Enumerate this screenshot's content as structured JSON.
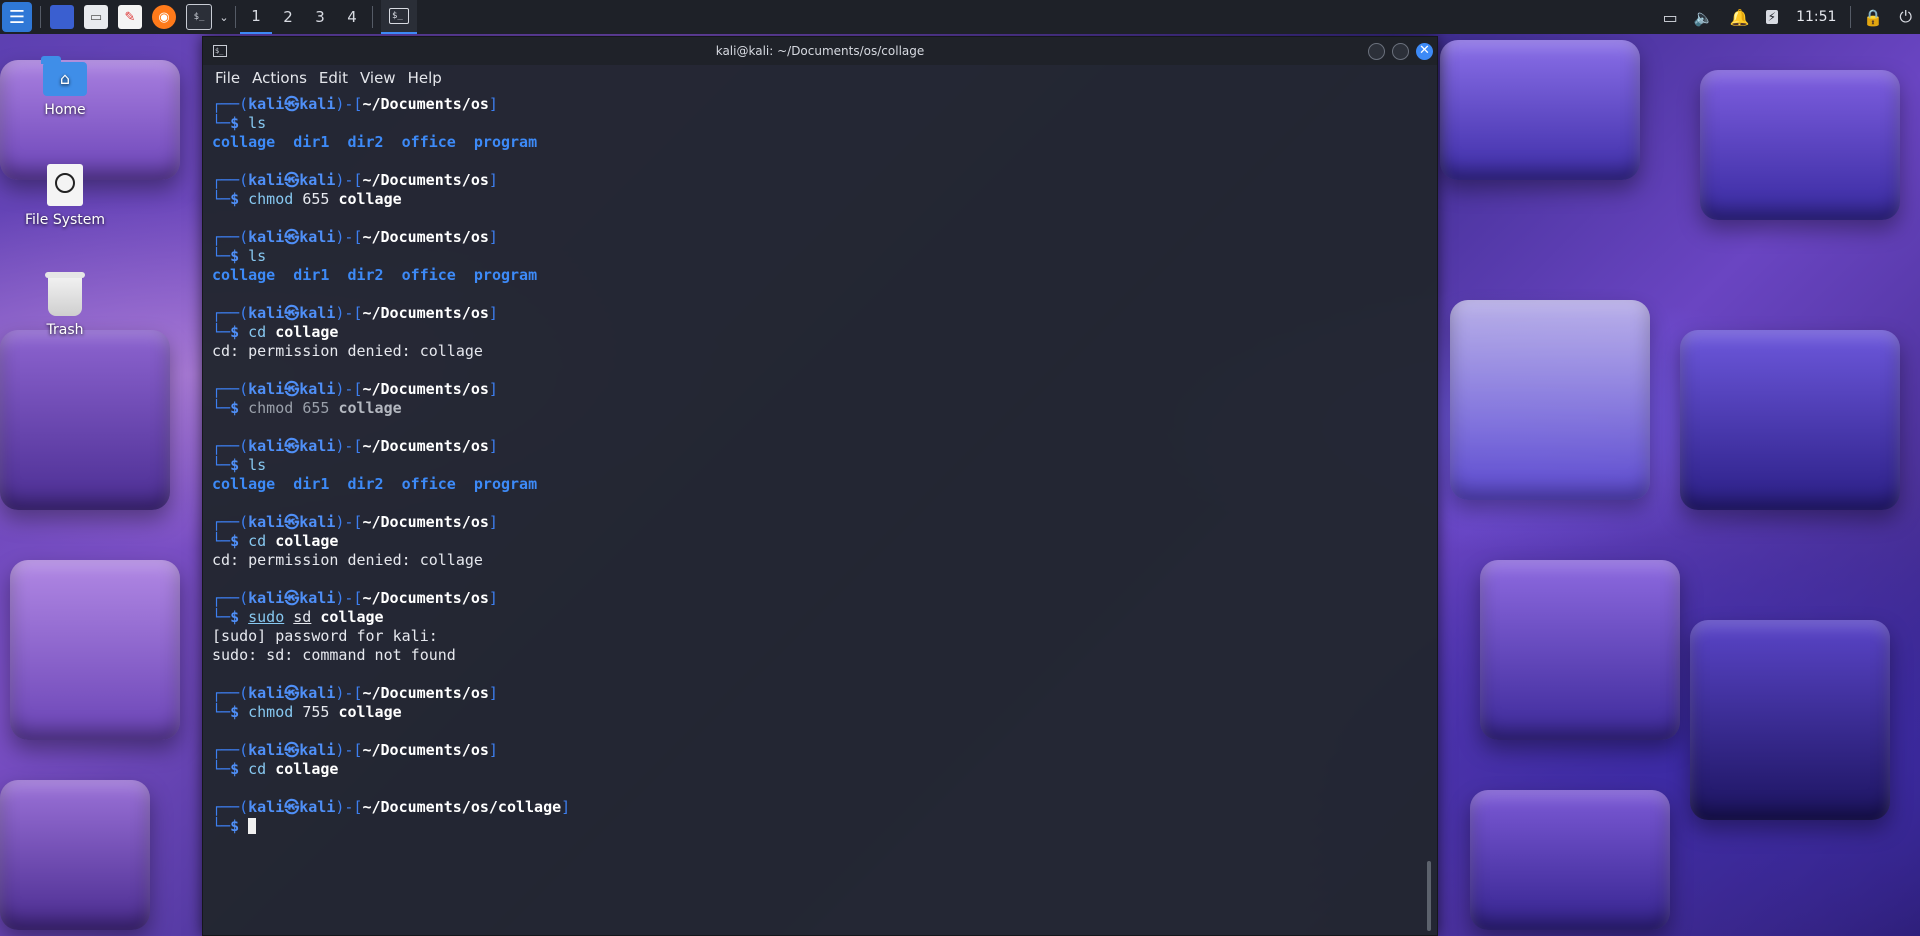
{
  "panel": {
    "workspaces": [
      "1",
      "2",
      "3",
      "4"
    ],
    "clock": "11:51",
    "icons": [
      "kali-menu-icon",
      "show-desktop-icon",
      "file-manager-icon",
      "text-editor-icon",
      "firefox-icon",
      "terminal-icon",
      "chevron-down-icon",
      "display-icon",
      "volume-icon",
      "notification-icon",
      "battery-icon",
      "lock-icon",
      "power-icon"
    ]
  },
  "desktop": {
    "icons": [
      {
        "label": "Home",
        "icon": "home-folder-icon"
      },
      {
        "label": "File System",
        "icon": "drive-icon"
      },
      {
        "label": "Trash",
        "icon": "trash-icon"
      }
    ]
  },
  "window": {
    "title": "kali@kali: ~/Documents/os/collage",
    "menu": [
      "File",
      "Actions",
      "Edit",
      "View",
      "Help"
    ]
  },
  "terminal": {
    "prompt_top": "┌──(",
    "prompt_bottom": "└─",
    "user": "kali㉿kali",
    "mid": ")-[",
    "close_bracket": "]",
    "dollar": "$",
    "path_os": "~/Documents/os",
    "path_collage": "~/Documents/os/collage",
    "ls_entries": [
      "collage",
      "dir1",
      "dir2",
      "office",
      "program"
    ],
    "commands": [
      {
        "cmd": "ls",
        "args": ""
      },
      {
        "cmd": "chmod",
        "num": "655",
        "args": "collage"
      },
      {
        "cmd": "ls",
        "args": ""
      },
      {
        "cmd": "cd",
        "args": "collage"
      },
      {
        "cmd": "chmod",
        "num": "655",
        "args": "collage"
      },
      {
        "cmd": "ls",
        "args": ""
      },
      {
        "cmd": "cd",
        "args": "collage"
      },
      {
        "cmd": "sudo",
        "sub": "sd",
        "args": "collage"
      },
      {
        "cmd": "chmod",
        "num": "755",
        "args": "collage"
      },
      {
        "cmd": "cd",
        "args": "collage"
      }
    ],
    "outputs": {
      "cd_denied": "cd: permission denied: collage",
      "sudo_password": "[sudo] password for kali:",
      "sudo_notfound": "sudo: sd: command not found"
    }
  }
}
